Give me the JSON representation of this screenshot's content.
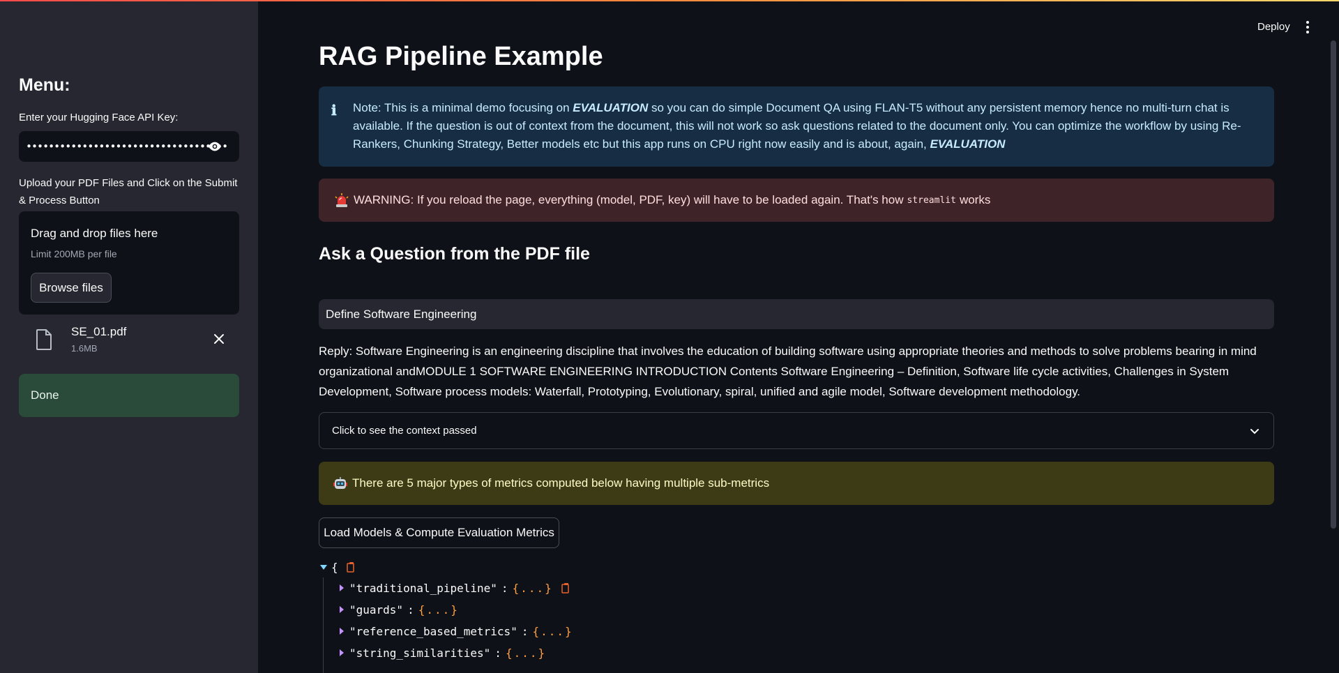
{
  "sidebar": {
    "title": "Menu:",
    "api_key_label": "Enter your Hugging Face API Key:",
    "api_key_value": "••••••••••••••••••••••••••••••••••••",
    "upload_label": "Upload your PDF Files and Click on the Submit & Process Button",
    "dropzone": {
      "title": "Drag and drop files here",
      "limit": "Limit 200MB per file",
      "browse_label": "Browse files"
    },
    "uploaded_file": {
      "name": "SE_01.pdf",
      "size": "1.6MB"
    },
    "status": "Done"
  },
  "header": {
    "deploy_label": "Deploy"
  },
  "main": {
    "title": "RAG Pipeline Example",
    "info": {
      "prefix": "Note: This is a minimal demo focusing on ",
      "emphasis1": "EVALUATION",
      "middle": " so you can do simple Document QA using FLAN-T5 without any persistent memory hence no multi-turn chat is available. If the question is out of context from the document, this will not work so ask questions related to the document only. You can optimize the workflow by using Re-Rankers, Chunking Strategy, Better models etc but this app runs on CPU right now easily and is about, again, ",
      "emphasis2": "EVALUATION"
    },
    "warning": {
      "text_before": "WARNING: If you reload the page, everything (model, PDF, key) will have to be loaded again. That's how",
      "code": "streamlit",
      "text_after": "works"
    },
    "section_title": "Ask a Question from the PDF file",
    "question_value": "Define Software Engineering",
    "reply": "Reply: Software Engineering is an engineering discipline that involves the education of building software using appropriate theories and methods to solve problems bearing in mind organizational andMODULE 1 SOFTWARE ENGINEERING INTRODUCTION Contents Software Engineering – Definition, Software life cycle activities, Challenges in System Development, Software process models: Waterfall, Prototyping, Evolutionary, spiral, unified and agile model, Software development methodology.",
    "expander_label": "Click to see the context passed",
    "metrics_note": "There are 5 major types of metrics computed below having multiple sub-metrics",
    "compute_button": "Load Models & Compute Evaluation Metrics",
    "json": {
      "open_brace": "{",
      "rows": [
        {
          "key": "\"traditional_pipeline\"",
          "colon": ":",
          "value": "{...}"
        },
        {
          "key": "\"guards\"",
          "colon": ":",
          "value": "{...}"
        },
        {
          "key": "\"reference_based_metrics\"",
          "colon": ":",
          "value": "{...}"
        },
        {
          "key": "\"string_similarities\"",
          "colon": ":",
          "value": "{...}"
        }
      ]
    }
  },
  "colors": {
    "background": "#0e1117",
    "sidebar": "#262730",
    "info_bg": "#172d43",
    "warning_bg": "#3e2428",
    "notice_bg": "#3d3b16",
    "success_bg": "#2a4a3a",
    "ellipsis": "#ff9f43"
  },
  "icons": [
    "eye-icon",
    "file-icon",
    "close-icon",
    "info-icon",
    "siren-icon",
    "chevron-down-icon",
    "robot-icon",
    "copy-icon",
    "kebab-menu-icon"
  ]
}
